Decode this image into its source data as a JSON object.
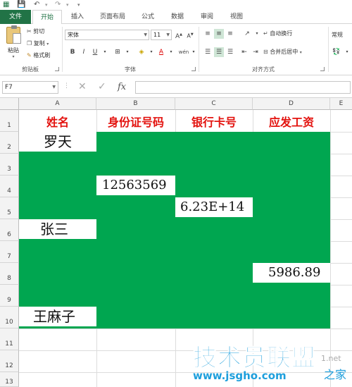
{
  "app": {
    "brand_color": "#217346",
    "quick_access": [
      "save-icon",
      "undo-icon",
      "redo-icon",
      "customize-icon"
    ]
  },
  "tabs": [
    {
      "label": "文件"
    },
    {
      "label": "开始"
    },
    {
      "label": "插入"
    },
    {
      "label": "页面布局"
    },
    {
      "label": "公式"
    },
    {
      "label": "数据"
    },
    {
      "label": "审阅"
    },
    {
      "label": "视图"
    }
  ],
  "ribbon": {
    "clipboard": {
      "paste": "粘贴",
      "cut": "剪切",
      "copy": "复制",
      "format_painter": "格式刷",
      "group_label": "剪贴板"
    },
    "font": {
      "font_name": "宋体",
      "font_size": "11",
      "grow": "A",
      "shrink": "A",
      "bold": "B",
      "italic": "I",
      "underline": "U",
      "font_color_glyph": "A",
      "phonetic_glyph": "wén",
      "group_label": "字体"
    },
    "alignment": {
      "wrap_text": "自动换行",
      "merge_center": "合并后居中",
      "group_label": "对齐方式"
    },
    "number": {
      "format": "常规"
    }
  },
  "formula_bar": {
    "name_box": "F7",
    "fx": "fx",
    "formula": ""
  },
  "sheet": {
    "fill_color": "#00a650",
    "header_color": "#e3130f",
    "columns": [
      "A",
      "B",
      "C",
      "D",
      "E"
    ],
    "rows": [
      "1",
      "2",
      "3",
      "4",
      "5",
      "6",
      "7",
      "8",
      "9",
      "10",
      "11",
      "12",
      "13"
    ],
    "headers": [
      "姓名",
      "身份证号码",
      "银行卡号",
      "应发工资"
    ],
    "cells": {
      "A2": "罗天",
      "B4": "12563569",
      "C5": "6.23E+14",
      "A6": "张三",
      "D8": "5986.89",
      "A10": "王麻子"
    }
  },
  "watermark": {
    "brand": "技术员联盟",
    "url": "www.jsgho.com",
    "side_text": "1.net",
    "side_text2": "之家"
  }
}
